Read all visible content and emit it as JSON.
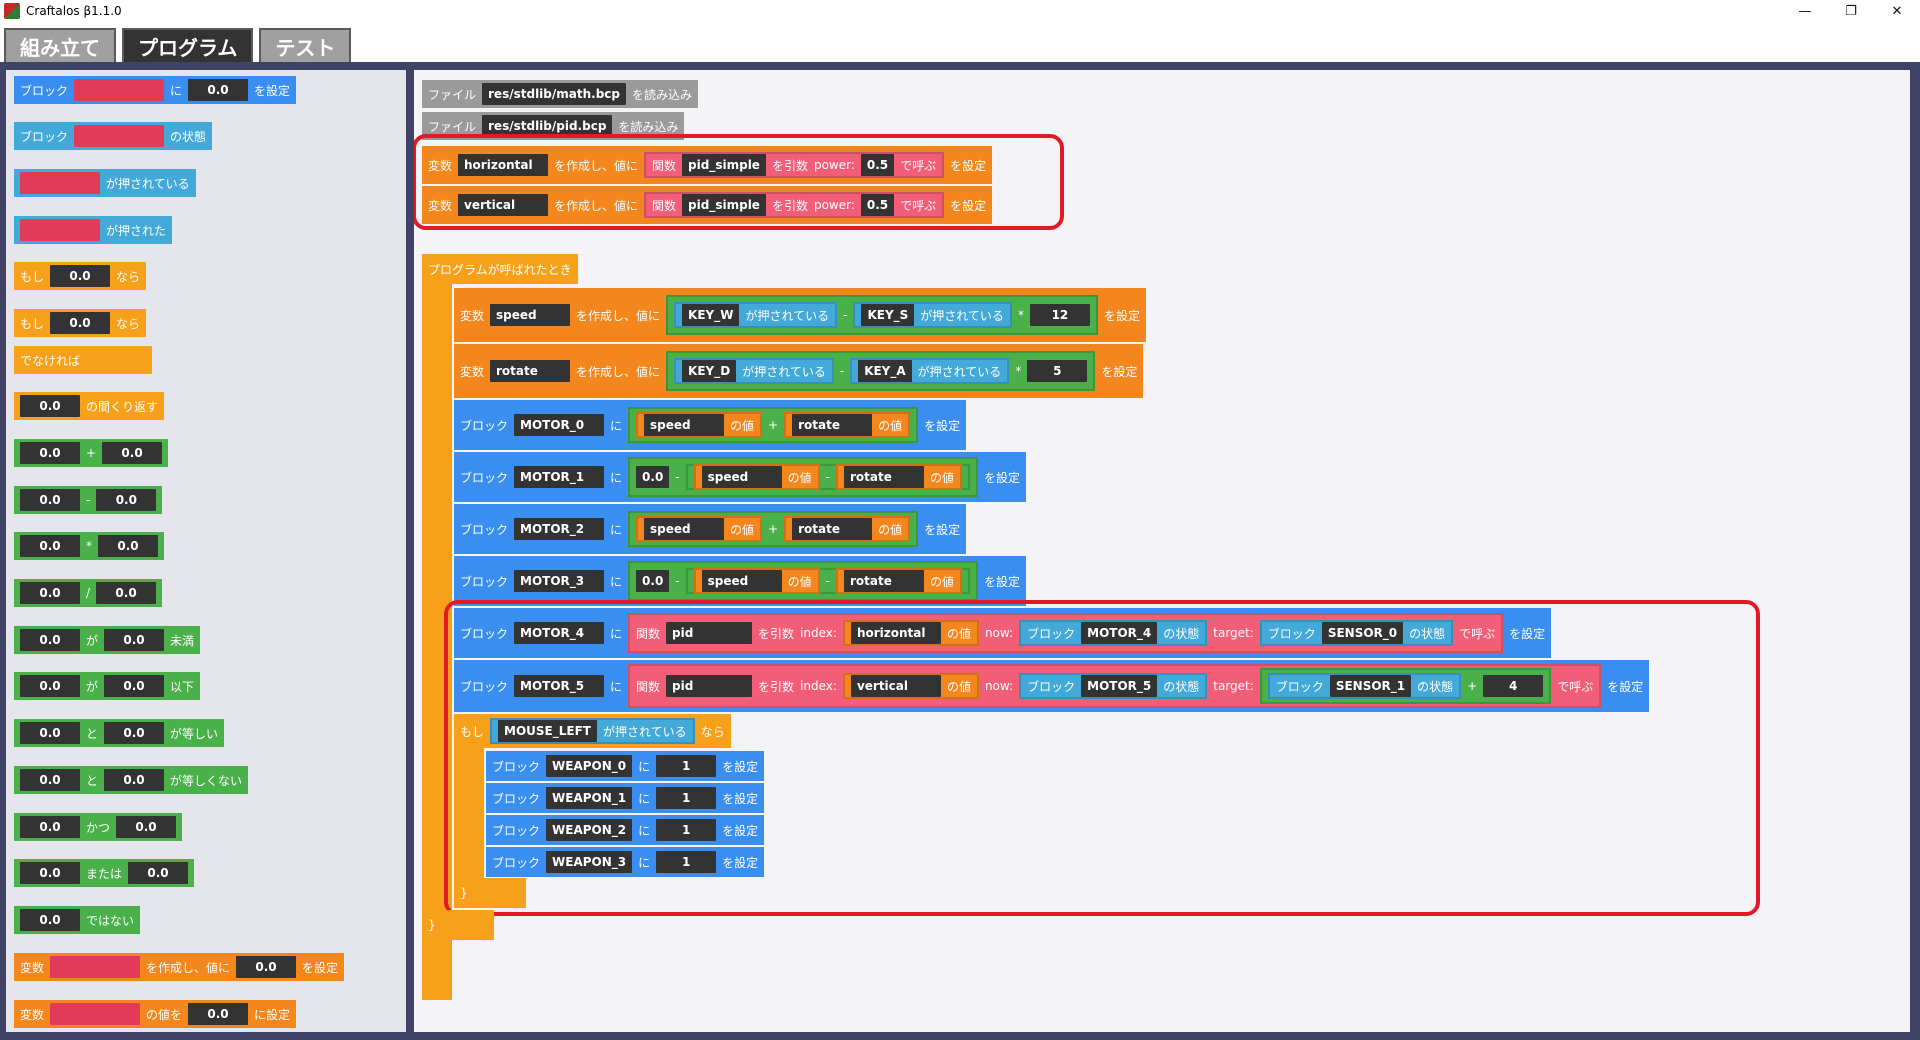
{
  "window": {
    "title": "Craftalos β1.1.0",
    "controls": [
      "—",
      "❐",
      "✕"
    ]
  },
  "tabs": [
    {
      "label": "組み立て"
    },
    {
      "label": "プログラム"
    },
    {
      "label": "テスト"
    }
  ],
  "palette": {
    "b1": {
      "prefix": "ブロック",
      "mid": "に",
      "val": "0.0",
      "suffix": "を設定"
    },
    "b2": {
      "prefix": "ブロック",
      "suffix": "の状態"
    },
    "b3": {
      "suffix": "が押されている"
    },
    "b4": {
      "suffix": "が押された"
    },
    "b5": {
      "prefix": "もし",
      "val": "0.0",
      "suffix": "なら"
    },
    "b6": {
      "prefix": "もし",
      "val": "0.0",
      "suffix": "なら",
      "else": "でなければ"
    },
    "b7": {
      "val": "0.0",
      "suffix": "の間くり返す"
    },
    "b8": {
      "a": "0.0",
      "op": "+",
      "b": "0.0"
    },
    "b9": {
      "a": "0.0",
      "op": "-",
      "b": "0.0"
    },
    "b10": {
      "a": "0.0",
      "op": "*",
      "b": "0.0"
    },
    "b11": {
      "a": "0.0",
      "op": "/",
      "b": "0.0"
    },
    "b12": {
      "a": "0.0",
      "op": "が",
      "b": "0.0",
      "suffix": "未満"
    },
    "b13": {
      "a": "0.0",
      "op": "が",
      "b": "0.0",
      "suffix": "以下"
    },
    "b14": {
      "a": "0.0",
      "op": "と",
      "b": "0.0",
      "suffix": "が等しい"
    },
    "b15": {
      "a": "0.0",
      "op": "と",
      "b": "0.0",
      "suffix": "が等しくない"
    },
    "b16": {
      "a": "0.0",
      "op": "かつ",
      "b": "0.0"
    },
    "b17": {
      "a": "0.0",
      "op": "または",
      "b": "0.0"
    },
    "b18": {
      "a": "0.0",
      "suffix": "ではない"
    },
    "b19": {
      "prefix": "変数",
      "mid": "を作成し、値に",
      "val": "0.0",
      "suffix": "を設定"
    },
    "b20": {
      "prefix": "変数",
      "mid": "の値を",
      "val": "0.0",
      "suffix": "に設定"
    }
  },
  "ws": {
    "load1": {
      "prefix": "ファイル",
      "file": "res/stdlib/math.bcp",
      "suffix": "を読み込み"
    },
    "load2": {
      "prefix": "ファイル",
      "file": "res/stdlib/pid.bcp",
      "suffix": "を読み込み"
    },
    "v_h": {
      "prefix": "変数",
      "name": "horizontal",
      "mid": "を作成し、値に",
      "fn": "関数",
      "fname": "pid_simple",
      "arg": "を引数",
      "param": "power:",
      "pval": "0.5",
      "call": "で呼ぶ",
      "suffix": "を設定"
    },
    "v_v": {
      "prefix": "変数",
      "name": "vertical",
      "mid": "を作成し、値に",
      "fn": "関数",
      "fname": "pid_simple",
      "arg": "を引数",
      "param": "power:",
      "pval": "0.5",
      "call": "で呼ぶ",
      "suffix": "を設定"
    },
    "event": {
      "label": "プログラムが呼ばれたとき"
    },
    "speed": {
      "prefix": "変数",
      "name": "speed",
      "mid": "を作成し、値に",
      "k1": "KEY_W",
      "p1": "が押されている",
      "op": "-",
      "k2": "KEY_S",
      "p2": "が押されている",
      "mul": "*",
      "n": "12",
      "suffix": "を設定"
    },
    "rotate": {
      "prefix": "変数",
      "name": "rotate",
      "mid": "を作成し、値に",
      "k1": "KEY_D",
      "p1": "が押されている",
      "op": "-",
      "k2": "KEY_A",
      "p2": "が押されている",
      "mul": "*",
      "n": "5",
      "suffix": "を設定"
    },
    "m0": {
      "prefix": "ブロック",
      "name": "MOTOR_0",
      "ni": "に",
      "a": "speed",
      "av": "の値",
      "op": "+",
      "b": "rotate",
      "bv": "の値",
      "suffix": "を設定"
    },
    "m1": {
      "prefix": "ブロック",
      "name": "MOTOR_1",
      "ni": "に",
      "z": "0.0",
      "op1": "-",
      "a": "speed",
      "av": "の値",
      "op2": "-",
      "b": "rotate",
      "bv": "の値",
      "suffix": "を設定"
    },
    "m2": {
      "prefix": "ブロック",
      "name": "MOTOR_2",
      "ni": "に",
      "a": "speed",
      "av": "の値",
      "op": "+",
      "b": "rotate",
      "bv": "の値",
      "suffix": "を設定"
    },
    "m3": {
      "prefix": "ブロック",
      "name": "MOTOR_3",
      "ni": "に",
      "z": "0.0",
      "op1": "-",
      "a": "speed",
      "av": "の値",
      "op2": "-",
      "b": "rotate",
      "bv": "の値",
      "suffix": "を設定"
    },
    "m4": {
      "prefix": "ブロック",
      "name": "MOTOR_4",
      "ni": "に",
      "fn": "関数",
      "fname": "pid",
      "arg": "を引数",
      "index": "index:",
      "iv": "horizontal",
      "ivv": "の値",
      "now": "now:",
      "nb": "ブロック",
      "nname": "MOTOR_4",
      "nstate": "の状態",
      "target": "target:",
      "tb": "ブロック",
      "tname": "SENSOR_0",
      "tstate": "の状態",
      "call": "で呼ぶ",
      "suffix": "を設定"
    },
    "m5": {
      "prefix": "ブロック",
      "name": "MOTOR_5",
      "ni": "に",
      "fn": "関数",
      "fname": "pid",
      "arg": "を引数",
      "index": "index:",
      "iv": "vertical",
      "ivv": "の値",
      "now": "now:",
      "nb": "ブロック",
      "nname": "MOTOR_5",
      "nstate": "の状態",
      "target": "target:",
      "tb": "ブロック",
      "tname": "SENSOR_1",
      "tstate": "の状態",
      "plus": "+",
      "tn": "4",
      "call": "で呼ぶ",
      "suffix": "を設定"
    },
    "ifm": {
      "prefix": "もし",
      "key": "MOUSE_LEFT",
      "pressed": "が押されている",
      "suffix": "なら"
    },
    "w0": {
      "prefix": "ブロック",
      "name": "WEAPON_0",
      "ni": "に",
      "val": "1",
      "suffix": "を設定"
    },
    "w1": {
      "prefix": "ブロック",
      "name": "WEAPON_1",
      "ni": "に",
      "val": "1",
      "suffix": "を設定"
    },
    "w2": {
      "prefix": "ブロック",
      "name": "WEAPON_2",
      "ni": "に",
      "val": "1",
      "suffix": "を設定"
    },
    "w3": {
      "prefix": "ブロック",
      "name": "WEAPON_3",
      "ni": "に",
      "val": "1",
      "suffix": "を設定"
    },
    "close_inner": "}",
    "close_outer": "}"
  },
  "colors": {
    "variable": "#f3861c",
    "block": "#3a8ef0",
    "sensor": "#43a9d8",
    "math": "#49b04a",
    "control": "#f7a11a",
    "function": "#f25d78",
    "highlight": "#e01a26"
  }
}
